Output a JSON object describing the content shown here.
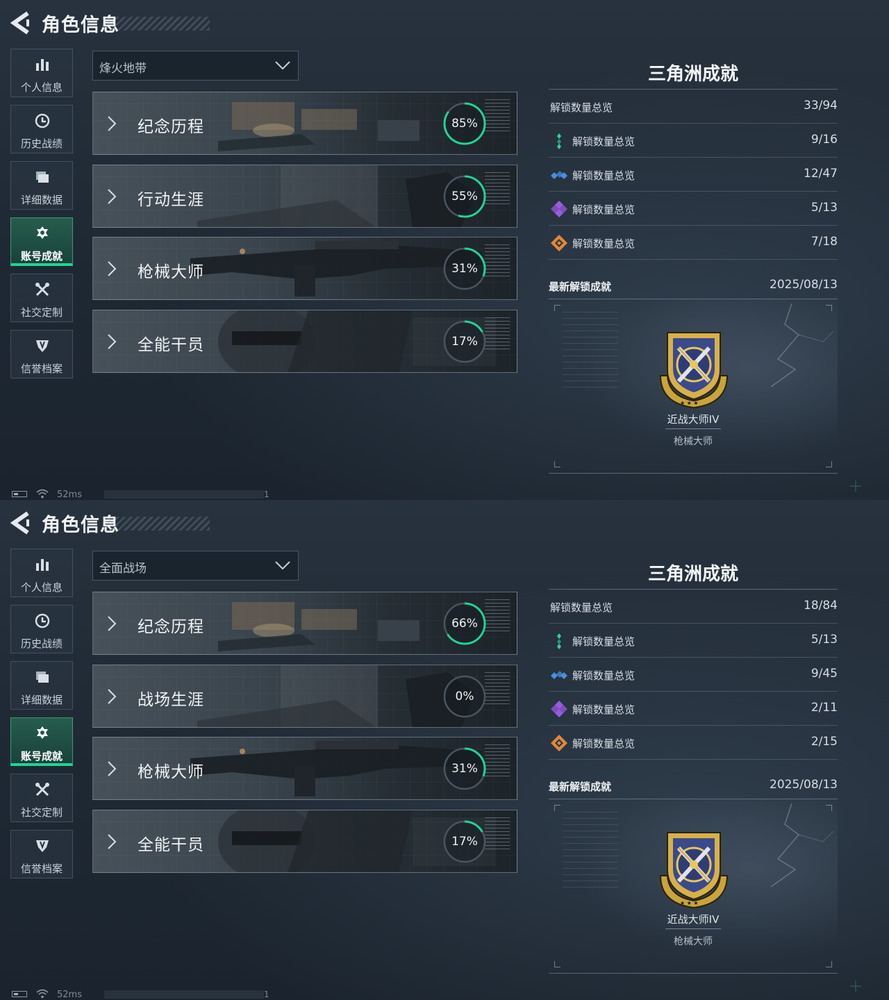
{
  "screens": [
    {
      "header": {
        "title": "角色信息"
      },
      "sidebar": [
        {
          "label": "个人信息",
          "icon": "bar-chart-icon",
          "active": false
        },
        {
          "label": "历史战绩",
          "icon": "clock-icon",
          "active": false
        },
        {
          "label": "详细数据",
          "icon": "folder-icon",
          "active": false
        },
        {
          "label": "账号成就",
          "icon": "medal-icon",
          "active": true
        },
        {
          "label": "社交定制",
          "icon": "tools-icon",
          "active": false
        },
        {
          "label": "信誉档案",
          "icon": "shield-icon",
          "active": false
        }
      ],
      "mode_select": {
        "value": "烽火地带"
      },
      "cards": [
        {
          "title": "纪念历程",
          "progress": 85,
          "progress_text": "85%"
        },
        {
          "title": "行动生涯",
          "progress": 55,
          "progress_text": "55%"
        },
        {
          "title": "枪械大师",
          "progress": 31,
          "progress_text": "31%"
        },
        {
          "title": "全能干员",
          "progress": 17,
          "progress_text": "17%"
        }
      ],
      "panel": {
        "title": "三角洲成就",
        "total": {
          "label": "解锁数量总览",
          "value": "33/94"
        },
        "tiers": [
          {
            "label": "解锁数量总览",
            "value": "9/16",
            "icon": "green-tier-icon",
            "color": "#2fd39a"
          },
          {
            "label": "解锁数量总览",
            "value": "12/47",
            "icon": "blue-tier-icon",
            "color": "#4a8fe0"
          },
          {
            "label": "解锁数量总览",
            "value": "5/13",
            "icon": "purple-tier-icon",
            "color": "#9a5be0"
          },
          {
            "label": "解锁数量总览",
            "value": "7/18",
            "icon": "orange-tier-icon",
            "color": "#e0873a"
          }
        ],
        "latest_label": "最新解锁成就",
        "latest_date": "2025/08/13",
        "badge_name": "近战大师IV",
        "badge_category": "枪械大师"
      },
      "status": {
        "ping": "52ms",
        "marker": "1"
      }
    },
    {
      "header": {
        "title": "角色信息"
      },
      "sidebar": [
        {
          "label": "个人信息",
          "icon": "bar-chart-icon",
          "active": false
        },
        {
          "label": "历史战绩",
          "icon": "clock-icon",
          "active": false
        },
        {
          "label": "详细数据",
          "icon": "folder-icon",
          "active": false
        },
        {
          "label": "账号成就",
          "icon": "medal-icon",
          "active": true
        },
        {
          "label": "社交定制",
          "icon": "tools-icon",
          "active": false
        },
        {
          "label": "信誉档案",
          "icon": "shield-icon",
          "active": false
        }
      ],
      "mode_select": {
        "value": "全面战场"
      },
      "cards": [
        {
          "title": "纪念历程",
          "progress": 66,
          "progress_text": "66%"
        },
        {
          "title": "战场生涯",
          "progress": 0,
          "progress_text": "0%"
        },
        {
          "title": "枪械大师",
          "progress": 31,
          "progress_text": "31%"
        },
        {
          "title": "全能干员",
          "progress": 17,
          "progress_text": "17%"
        }
      ],
      "panel": {
        "title": "三角洲成就",
        "total": {
          "label": "解锁数量总览",
          "value": "18/84"
        },
        "tiers": [
          {
            "label": "解锁数量总览",
            "value": "5/13",
            "icon": "green-tier-icon",
            "color": "#2fd39a"
          },
          {
            "label": "解锁数量总览",
            "value": "9/45",
            "icon": "blue-tier-icon",
            "color": "#4a8fe0"
          },
          {
            "label": "解锁数量总览",
            "value": "2/11",
            "icon": "purple-tier-icon",
            "color": "#9a5be0"
          },
          {
            "label": "解锁数量总览",
            "value": "2/15",
            "icon": "orange-tier-icon",
            "color": "#e0873a"
          }
        ],
        "latest_label": "最新解锁成就",
        "latest_date": "2025/08/13",
        "badge_name": "近战大师IV",
        "badge_category": "枪械大师"
      },
      "status": {
        "ping": "52ms",
        "marker": "1"
      }
    }
  ],
  "colors": {
    "accent": "#21d493",
    "ring_track": "#4a5560"
  }
}
